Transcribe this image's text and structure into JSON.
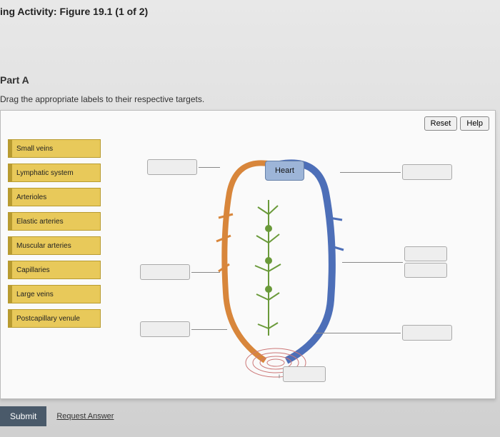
{
  "header": {
    "title": "ing Activity: Figure 19.1 (1 of 2)"
  },
  "part": {
    "label": "Part A",
    "instruction": "Drag the appropriate labels to their respective targets."
  },
  "toolbar": {
    "reset": "Reset",
    "help": "Help"
  },
  "labels": [
    "Small veins",
    "Lymphatic system",
    "Arterioles",
    "Elastic arteries",
    "Muscular arteries",
    "Capillaries",
    "Large veins",
    "Postcapillary venule"
  ],
  "fixed": {
    "heart": "Heart"
  },
  "actions": {
    "submit": "Submit",
    "request": "Request Answer"
  }
}
